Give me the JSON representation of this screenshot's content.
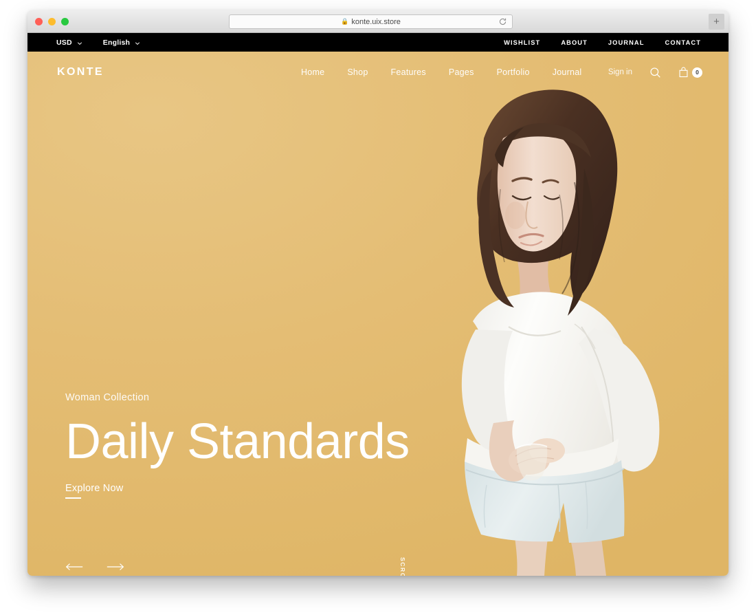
{
  "browser": {
    "url": "konte.uix.store",
    "lock_icon": "lock-icon",
    "reload_icon": "reload-icon",
    "newtab_label": "+",
    "traffic_lights": [
      "close",
      "minimize",
      "maximize"
    ]
  },
  "topbar": {
    "currency": {
      "label": "USD",
      "icon": "chevron-down-icon"
    },
    "language": {
      "label": "English",
      "icon": "chevron-down-icon"
    },
    "links": [
      {
        "label": "WISHLIST"
      },
      {
        "label": "ABOUT"
      },
      {
        "label": "JOURNAL"
      },
      {
        "label": "CONTACT"
      }
    ]
  },
  "header": {
    "logo": "KONTE",
    "menu": [
      {
        "label": "Home"
      },
      {
        "label": "Shop"
      },
      {
        "label": "Features"
      },
      {
        "label": "Pages"
      },
      {
        "label": "Portfolio"
      },
      {
        "label": "Journal"
      }
    ],
    "signin_label": "Sign in",
    "search_icon": "search-icon",
    "cart_icon": "shopping-bag-icon",
    "cart_count": "0"
  },
  "hero": {
    "eyebrow": "Woman Collection",
    "headline": "Daily Standards",
    "cta_label": "Explore Now",
    "prev_icon": "arrow-left-icon",
    "next_icon": "arrow-right-icon",
    "scroll_label": "SCROLL",
    "colors": {
      "background_top": "#e8c684",
      "background_bottom": "#dfb565",
      "topbar": "#000000",
      "text": "#ffffff",
      "garment_top": "#fbfbf8",
      "garment_shorts": "#dfe8e9",
      "hair": "#53372a",
      "skin": "#efd9c8"
    }
  }
}
